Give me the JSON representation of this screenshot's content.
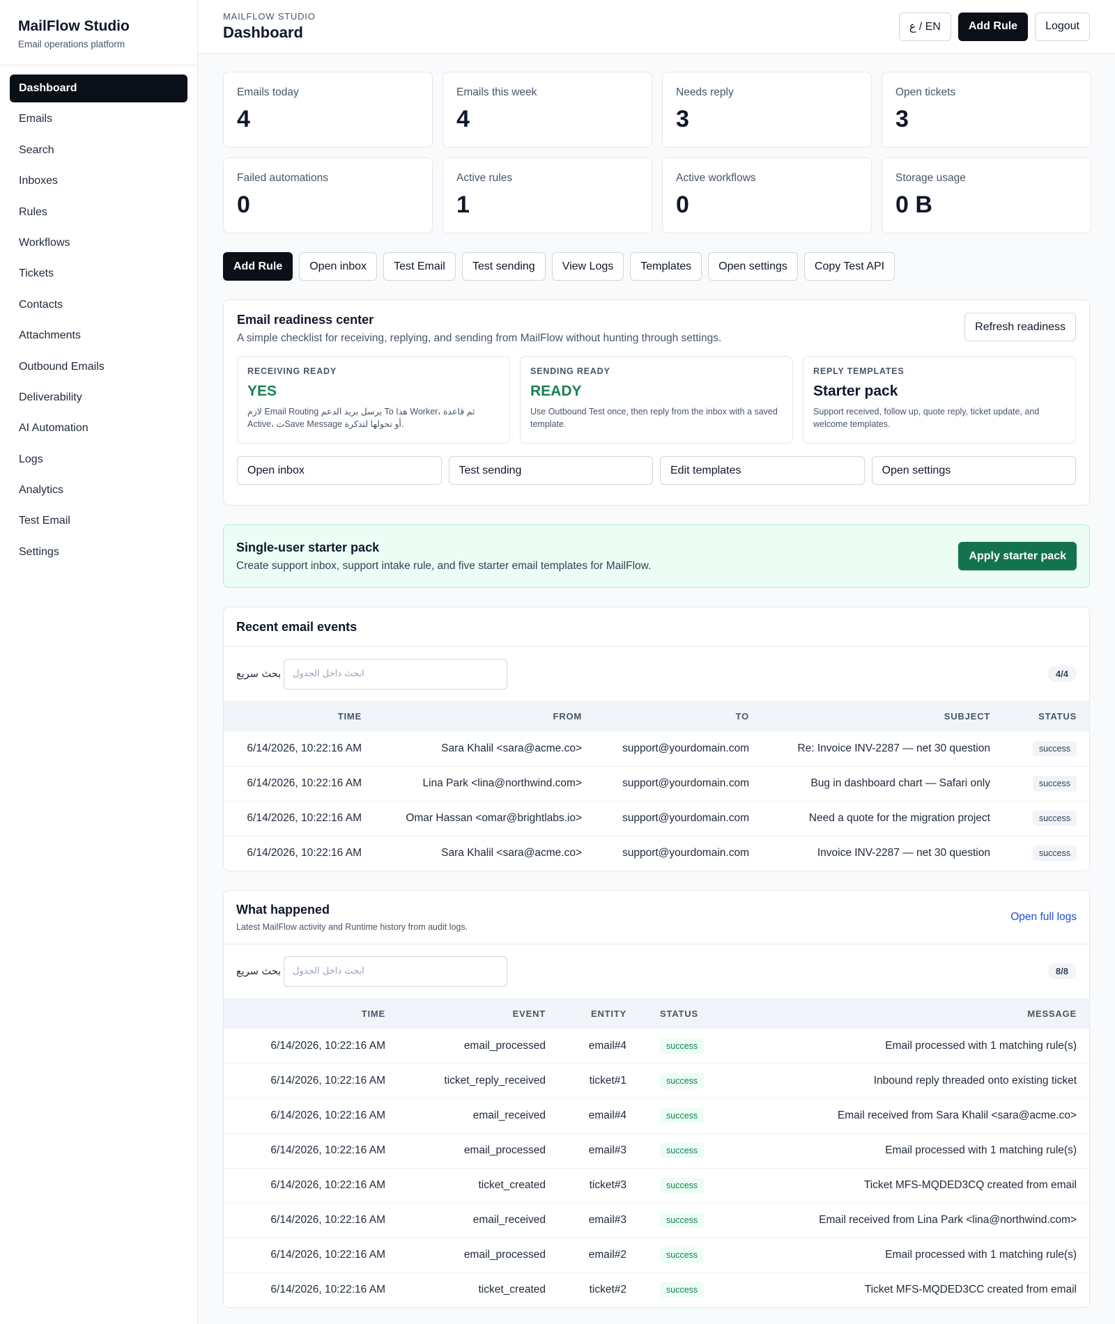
{
  "brand": {
    "name": "MailFlow Studio",
    "subtitle": "Email operations platform"
  },
  "sidebar": {
    "items": [
      {
        "label": "Dashboard",
        "active": true
      },
      {
        "label": "Emails"
      },
      {
        "label": "Search"
      },
      {
        "label": "Inboxes"
      },
      {
        "label": "Rules"
      },
      {
        "label": "Workflows"
      },
      {
        "label": "Tickets"
      },
      {
        "label": "Contacts"
      },
      {
        "label": "Attachments"
      },
      {
        "label": "Outbound Emails"
      },
      {
        "label": "Deliverability"
      },
      {
        "label": "AI Automation"
      },
      {
        "label": "Logs"
      },
      {
        "label": "Analytics"
      },
      {
        "label": "Test Email"
      },
      {
        "label": "Settings"
      }
    ]
  },
  "header": {
    "eyebrow": "MAILFLOW STUDIO",
    "title": "Dashboard",
    "lang_toggle": "ع / EN",
    "add_rule": "Add Rule",
    "logout": "Logout"
  },
  "stats": [
    {
      "label": "Emails today",
      "value": "4"
    },
    {
      "label": "Emails this week",
      "value": "4"
    },
    {
      "label": "Needs reply",
      "value": "3"
    },
    {
      "label": "Open tickets",
      "value": "3"
    },
    {
      "label": "Failed automations",
      "value": "0"
    },
    {
      "label": "Active rules",
      "value": "1"
    },
    {
      "label": "Active workflows",
      "value": "0"
    },
    {
      "label": "Storage usage",
      "value": "0 B"
    }
  ],
  "quick_actions": [
    "Add Rule",
    "Open inbox",
    "Test Email",
    "Test sending",
    "View Logs",
    "Templates",
    "Open settings",
    "Copy Test API"
  ],
  "readiness": {
    "title": "Email readiness center",
    "description": "A simple checklist for receiving, replying, and sending from MailFlow without hunting through settings.",
    "refresh": "Refresh readiness",
    "boxes": [
      {
        "label": "RECEIVING READY",
        "value": "YES",
        "desc": "لازم Email Routing يرسل بريد الدعم To هذا Worker، ثم قاعدة Active، تSave Message أو تحولها لتذكرة."
      },
      {
        "label": "SENDING READY",
        "value": "READY",
        "desc": "Use Outbound Test once, then reply from the inbox with a saved template."
      },
      {
        "label": "REPLY TEMPLATES",
        "value": "Starter pack",
        "desc": "Support received, follow up, quote reply, ticket update, and welcome templates."
      }
    ],
    "actions": [
      "Open inbox",
      "Test sending",
      "Edit templates",
      "Open settings"
    ]
  },
  "starter": {
    "title": "Single-user starter pack",
    "description": "Create support inbox, support intake rule, and five starter email templates for MailFlow.",
    "button": "Apply starter pack"
  },
  "recent": {
    "title": "Recent email events",
    "search_label": "بحث سريع",
    "search_placeholder": "ابحث داخل الجدول",
    "count": "4/4",
    "columns": [
      "TIME",
      "FROM",
      "TO",
      "SUBJECT",
      "STATUS"
    ],
    "rows": [
      [
        "6/14/2026, 10:22:16 AM",
        "Sara Khalil <sara@acme.co>",
        "support@yourdomain.com",
        "Re: Invoice INV-2287 — net 30 question",
        "success"
      ],
      [
        "6/14/2026, 10:22:16 AM",
        "Lina Park <lina@northwind.com>",
        "support@yourdomain.com",
        "Bug in dashboard chart — Safari only",
        "success"
      ],
      [
        "6/14/2026, 10:22:16 AM",
        "Omar Hassan <omar@brightlabs.io>",
        "support@yourdomain.com",
        "Need a quote for the migration project",
        "success"
      ],
      [
        "6/14/2026, 10:22:16 AM",
        "Sara Khalil <sara@acme.co>",
        "support@yourdomain.com",
        "Invoice INV-2287 — net 30 question",
        "success"
      ]
    ]
  },
  "happened": {
    "title": "What happened",
    "subtitle": "Latest MailFlow activity and Runtime history from audit logs.",
    "link": "Open full logs",
    "search_label": "بحث سريع",
    "search_placeholder": "ابحث داخل الجدول",
    "count": "8/8",
    "columns": [
      "TIME",
      "EVENT",
      "ENTITY",
      "STATUS",
      "MESSAGE"
    ],
    "rows": [
      [
        "6/14/2026, 10:22:16 AM",
        "email_processed",
        "email#4",
        "success",
        "Email processed with 1 matching rule(s)"
      ],
      [
        "6/14/2026, 10:22:16 AM",
        "ticket_reply_received",
        "ticket#1",
        "success",
        "Inbound reply threaded onto existing ticket"
      ],
      [
        "6/14/2026, 10:22:16 AM",
        "email_received",
        "email#4",
        "success",
        "Email received from Sara Khalil <sara@acme.co>"
      ],
      [
        "6/14/2026, 10:22:16 AM",
        "email_processed",
        "email#3",
        "success",
        "Email processed with 1 matching rule(s)"
      ],
      [
        "6/14/2026, 10:22:16 AM",
        "ticket_created",
        "ticket#3",
        "success",
        "Ticket MFS-MQDED3CQ created from email"
      ],
      [
        "6/14/2026, 10:22:16 AM",
        "email_received",
        "email#3",
        "success",
        "Email received from Lina Park <lina@northwind.com>"
      ],
      [
        "6/14/2026, 10:22:16 AM",
        "email_processed",
        "email#2",
        "success",
        "Email processed with 1 matching rule(s)"
      ],
      [
        "6/14/2026, 10:22:16 AM",
        "ticket_created",
        "ticket#2",
        "success",
        "Ticket MFS-MQDED3CC created from email"
      ]
    ]
  }
}
